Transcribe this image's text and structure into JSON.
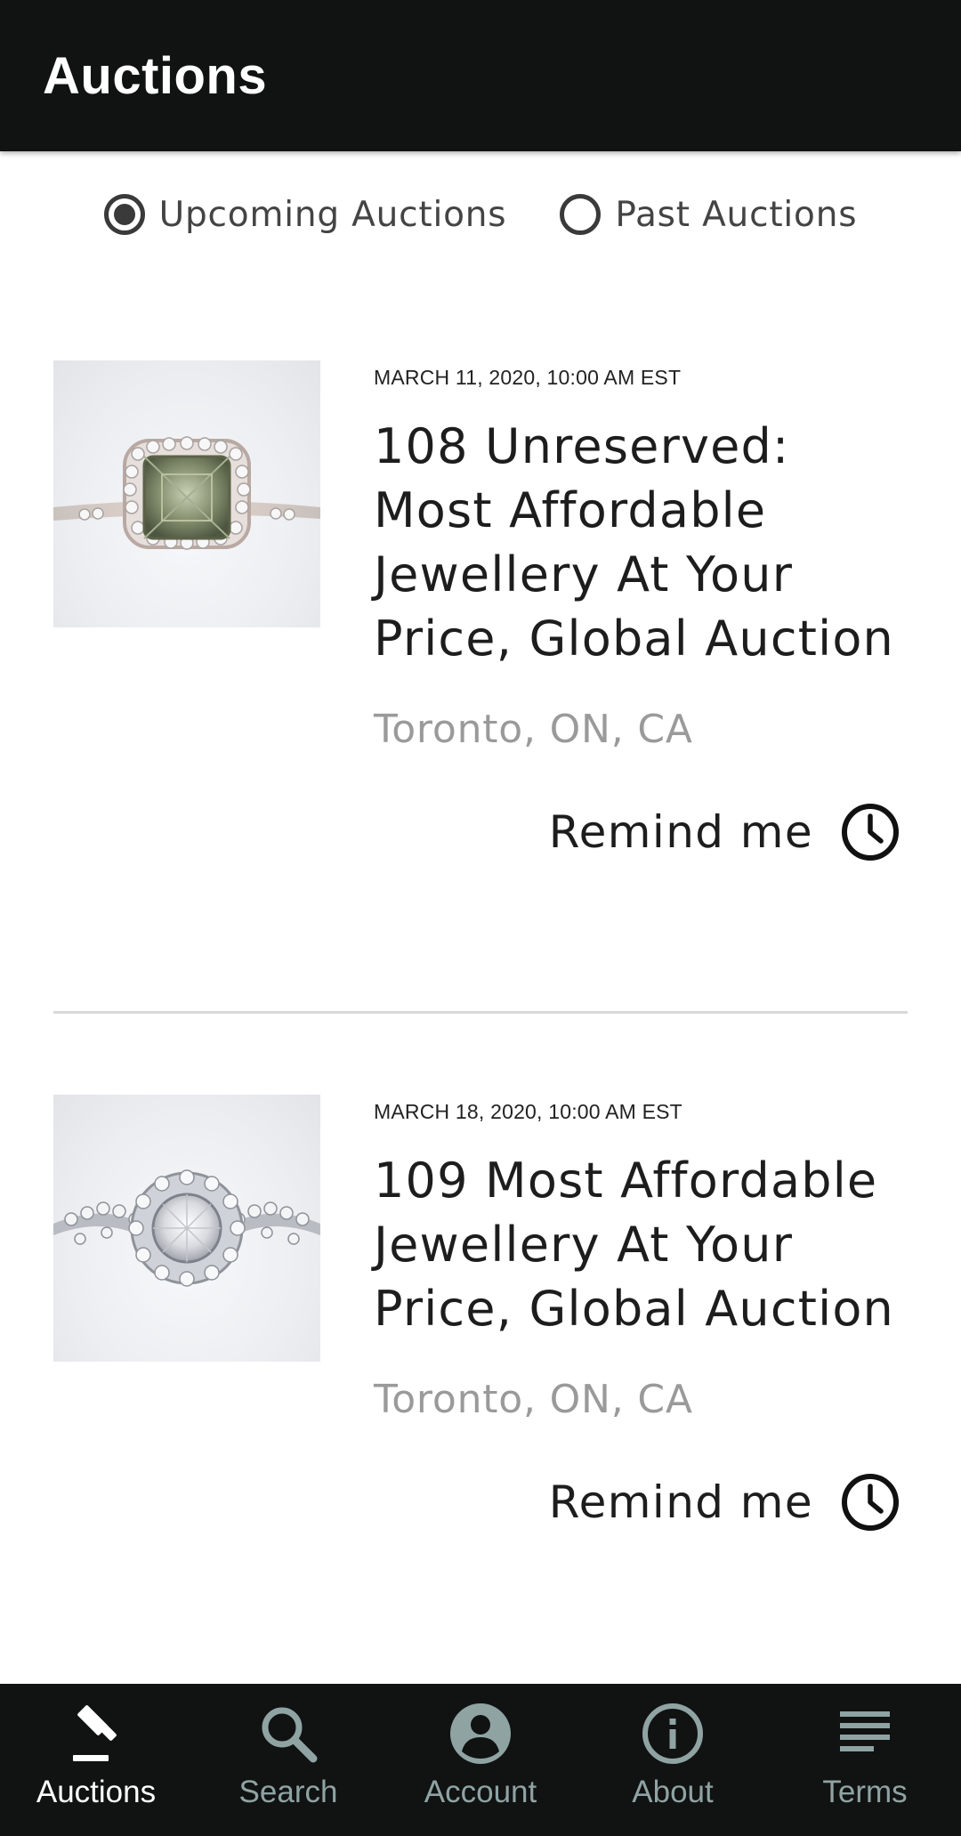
{
  "header": {
    "title": "Auctions"
  },
  "filter": {
    "options": [
      {
        "label": "Upcoming Auctions",
        "selected": true
      },
      {
        "label": "Past Auctions",
        "selected": false
      }
    ]
  },
  "auctions": [
    {
      "date": "MARCH 11, 2020, 10:00 AM EST",
      "title": "108 Unreserved: Most Affordable Jewellery At Your Price, Global Auction",
      "location": "Toronto, ON, CA",
      "remind_label": "Remind me",
      "image_icon": "green-gem-ring"
    },
    {
      "date": "MARCH 18, 2020, 10:00 AM EST",
      "title": "109 Most Affordable Jewellery At Your Price, Global Auction",
      "location": "Toronto, ON, CA",
      "remind_label": "Remind me",
      "image_icon": "diamond-halo-ring"
    }
  ],
  "bottom_nav": {
    "items": [
      {
        "label": "Auctions",
        "icon": "gavel-icon",
        "active": true
      },
      {
        "label": "Search",
        "icon": "search-icon",
        "active": false
      },
      {
        "label": "Account",
        "icon": "account-icon",
        "active": false
      },
      {
        "label": "About",
        "icon": "info-icon",
        "active": false
      },
      {
        "label": "Terms",
        "icon": "terms-icon",
        "active": false
      }
    ]
  },
  "colors": {
    "app_bar": "#111212",
    "nav_active": "#ffffff",
    "nav_inactive": "#8fa3a3",
    "location_text": "#9a9a9a"
  }
}
